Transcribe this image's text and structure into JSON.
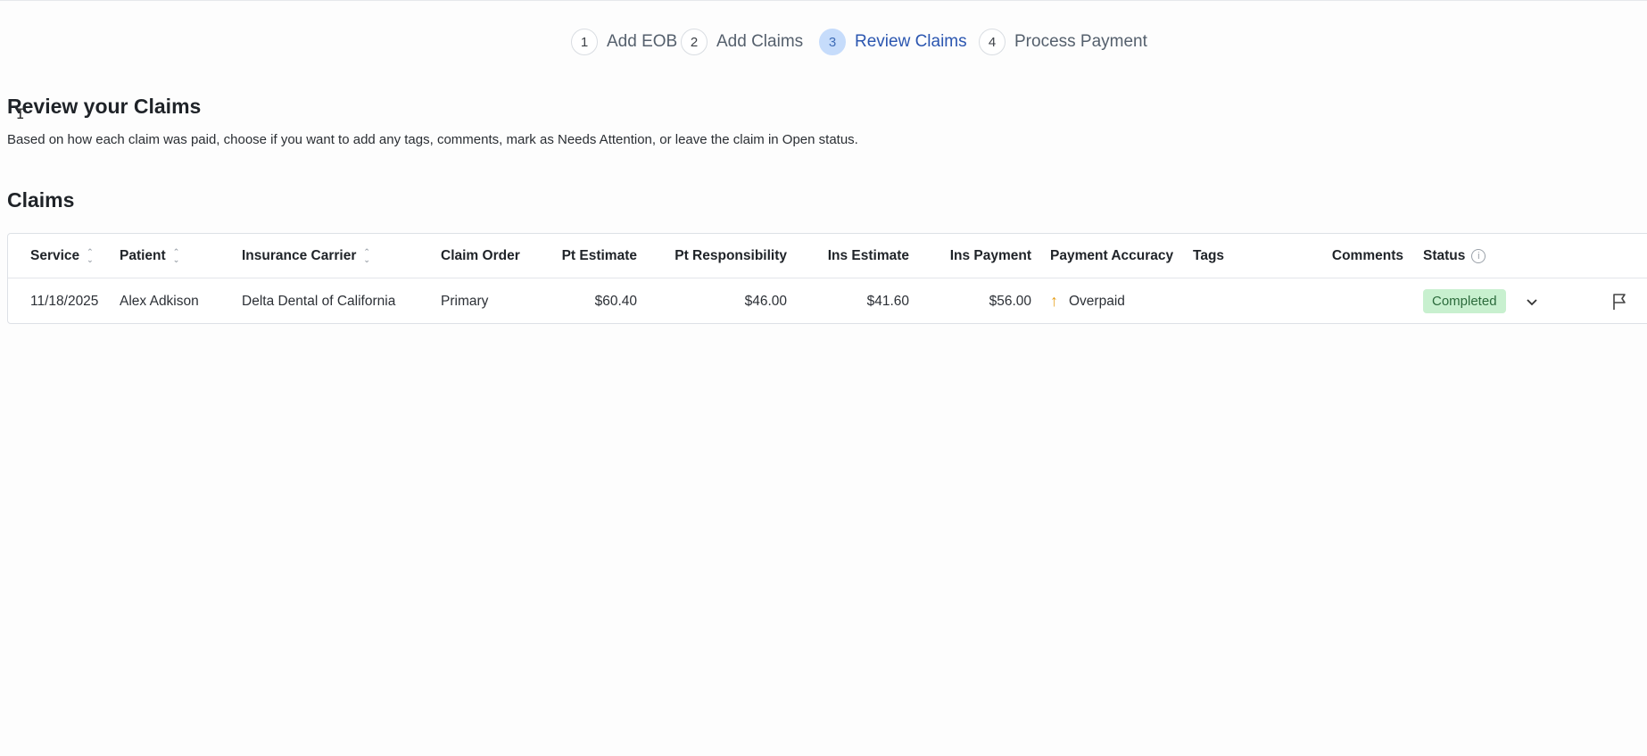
{
  "stepper": {
    "steps": [
      {
        "num": "1",
        "label": "Add EOB"
      },
      {
        "num": "2",
        "label": "Add Claims"
      },
      {
        "num": "3",
        "label": "Review Claims"
      },
      {
        "num": "4",
        "label": "Process Payment"
      }
    ],
    "active_step": 3
  },
  "page": {
    "title": "Review your Claims",
    "description": "Based on how each claim was paid, choose if you want to add any tags, comments, mark as Needs Attention, or leave the claim in Open status.",
    "section_title": "Claims"
  },
  "table": {
    "columns": {
      "service": "Service",
      "patient": "Patient",
      "carrier": "Insurance Carrier",
      "order": "Claim Order",
      "pt_estimate": "Pt Estimate",
      "pt_responsibility": "Pt Responsibility",
      "ins_estimate": "Ins Estimate",
      "ins_payment": "Ins Payment",
      "accuracy": "Payment Accuracy",
      "tags": "Tags",
      "comments": "Comments",
      "status": "Status"
    },
    "rows": [
      {
        "service": "11/18/2025",
        "patient": "Alex Adkison",
        "carrier": "Delta Dental of California",
        "order": "Primary",
        "pt_estimate": "$60.40",
        "pt_responsibility": "$46.00",
        "ins_estimate": "$41.60",
        "ins_payment": "$56.00",
        "accuracy": "Overpaid",
        "tags": "",
        "comments": "",
        "status": "Completed"
      }
    ]
  },
  "icons": {
    "sort": "sort-icon",
    "info": "info-icon",
    "accuracy": "arrow-up-icon",
    "dropdown": "chevron-down-icon",
    "flag": "flag-icon"
  },
  "colors": {
    "active_step_bg": "#c6dcfb",
    "active_step_text": "#2b56b0",
    "status_completed_bg": "#c8f0cf",
    "overpaid_arrow": "#e6a01c"
  }
}
